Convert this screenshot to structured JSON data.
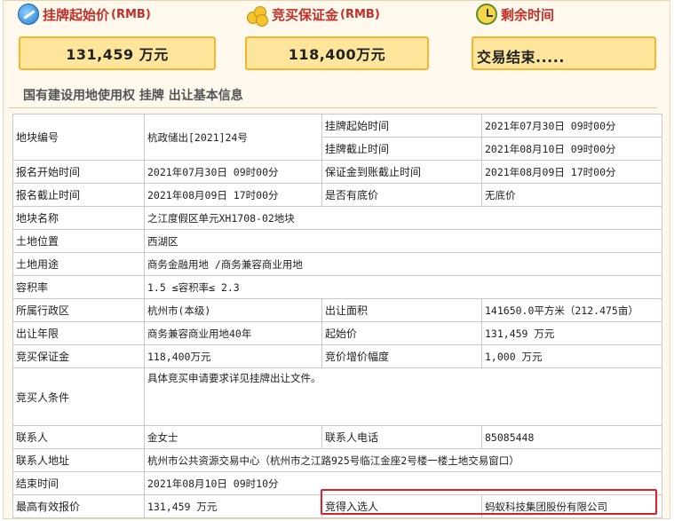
{
  "header": {
    "start_price_label": "挂牌起始价",
    "start_price_unit": "(RMB)",
    "deposit_label": "竞买保证金",
    "deposit_unit": "(RMB)",
    "remaining_label": "剩余时间"
  },
  "summary": {
    "start_price_value": "131,459 万元",
    "deposit_value": "118,400万元",
    "remaining_value": "交易结束....."
  },
  "section_title": "国有建设用地使用权 挂牌 出让基本信息",
  "rows": {
    "parcel_no_label": "地块编号",
    "parcel_no": "杭政储出[2021]24号",
    "listing_start_label": "挂牌起始时间",
    "listing_start": "2021年07月30日 09时00分",
    "listing_end_label": "挂牌截止时间",
    "listing_end": "2021年08月10日 09时00分",
    "reg_start_label": "报名开始时间",
    "reg_start": "2021年07月30日 09时00分",
    "deposit_deadline_label": "保证金到账截止时间",
    "deposit_deadline": "2021年08月09日 17时00分",
    "reg_end_label": "报名截止时间",
    "reg_end": "2021年08月09日 17时00分",
    "reserve_label": "是否有底价",
    "reserve": "无底价",
    "parcel_name_label": "地块名称",
    "parcel_name": "之江度假区单元XH1708-02地块",
    "location_label": "土地位置",
    "location": "西湖区",
    "usage_label": "土地用途",
    "usage": "商务金融用地 /商务兼容商业用地",
    "far_label": "容积率",
    "far": "1.5 ≤容积率≤ 2.3",
    "district_label": "所属行政区",
    "district": "杭州市(本级)",
    "area_label": "出让面积",
    "area": "141650.0平方米（212.475亩）",
    "term_label": "出让年限",
    "term": "商务兼容商业用地40年",
    "start_price_label": "起始价",
    "start_price": "131,459 万元",
    "deposit_label": "竞买保证金",
    "deposit": "118,400万元",
    "increment_label": "竞价增价幅度",
    "increment": "1,000 万元",
    "conditions_label": "竞买人条件",
    "conditions": "具体竞买申请要求详见挂牌出让文件。",
    "contact_label": "联系人",
    "contact": "金女士",
    "phone_label": "联系人电话",
    "phone": "85085448",
    "address_label": "联系人地址",
    "address": "杭州市公共资源交易中心（杭州市之江路925号临江金座2号楼一楼土地交易窗口）",
    "end_time_label": "结束时间",
    "end_time": "2021年08月10日 09时10分",
    "top_bid_label": "最高有效报价",
    "top_bid": "131,459 万元",
    "winner_label": "竞得入选人",
    "winner": "蚂蚁科技集团股份有限公司"
  },
  "colors": {
    "header_red": "#c0312b",
    "box_fill": "#fde59b",
    "box_border": "#f4b52c",
    "highlight_border": "#d8232a"
  },
  "icons": [
    "compass-icon",
    "coins-icon",
    "clock-icon"
  ]
}
